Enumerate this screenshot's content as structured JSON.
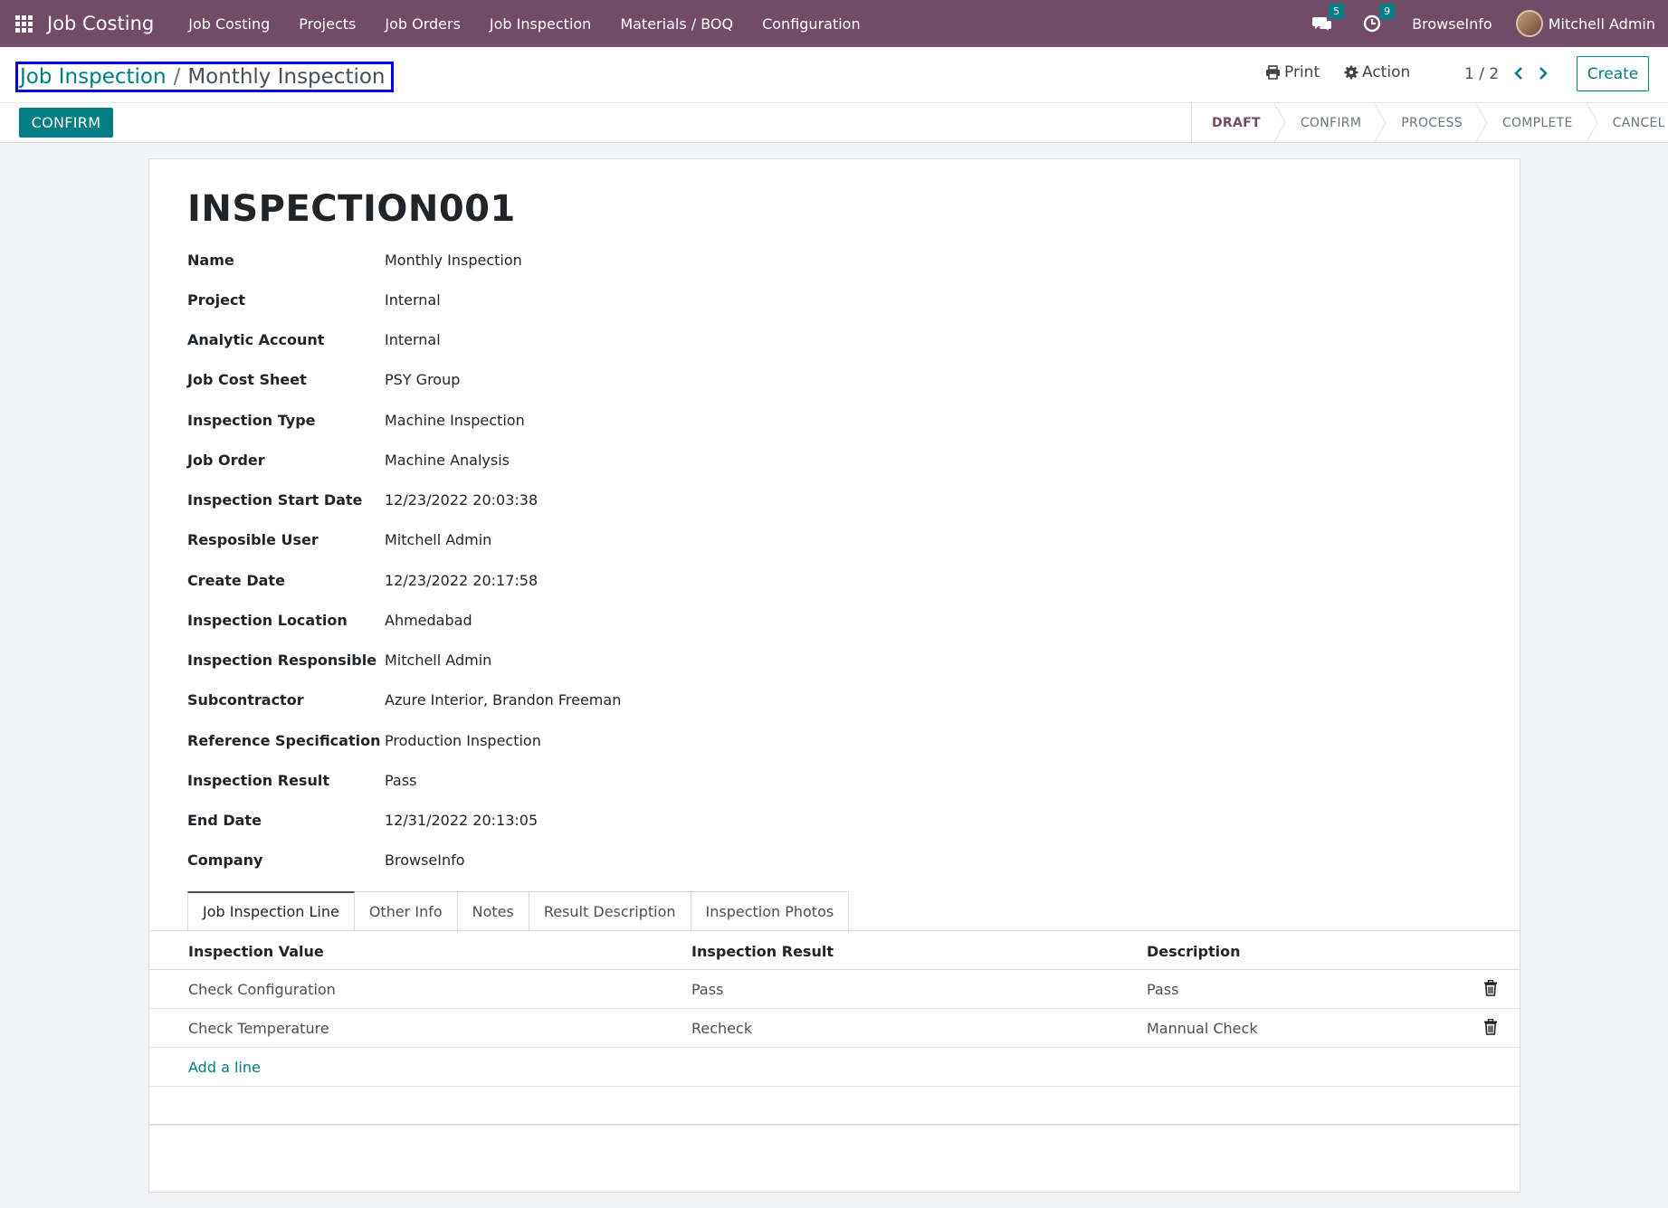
{
  "navbar": {
    "app_name": "Job Costing",
    "menu": [
      "Job Costing",
      "Projects",
      "Job Orders",
      "Job Inspection",
      "Materials / BOQ",
      "Configuration"
    ],
    "messages_count": "5",
    "activities_count": "9",
    "company": "BrowseInfo",
    "user": "Mitchell Admin"
  },
  "control": {
    "breadcrumb_parent": "Job Inspection",
    "breadcrumb_separator": "/",
    "breadcrumb_current": "Monthly Inspection",
    "print_label": "Print",
    "action_label": "Action",
    "pager": "1 / 2",
    "create_label": "Create",
    "confirm_label": "CONFIRM"
  },
  "statusbar": {
    "stages": [
      "DRAFT",
      "CONFIRM",
      "PROCESS",
      "COMPLETE",
      "CANCEL"
    ],
    "active": "DRAFT"
  },
  "record": {
    "title": "INSPECTION001",
    "fields": [
      {
        "label": "Name",
        "value": "Monthly Inspection"
      },
      {
        "label": "Project",
        "value": "Internal"
      },
      {
        "label": "Analytic Account",
        "value": "Internal"
      },
      {
        "label": "Job Cost Sheet",
        "value": "PSY Group"
      },
      {
        "label": "Inspection Type",
        "value": "Machine Inspection"
      },
      {
        "label": "Job Order",
        "value": "Machine Analysis"
      },
      {
        "label": "Inspection Start Date",
        "value": "12/23/2022 20:03:38"
      },
      {
        "label": "Resposible User",
        "value": "Mitchell Admin"
      },
      {
        "label": "Create Date",
        "value": "12/23/2022 20:17:58"
      },
      {
        "label": "Inspection Location",
        "value": "Ahmedabad"
      },
      {
        "label": "Inspection Responsible",
        "value": "Mitchell Admin"
      },
      {
        "label": "Subcontractor",
        "value": "Azure Interior, Brandon Freeman"
      },
      {
        "label": "Reference Specification",
        "value": "Production Inspection"
      },
      {
        "label": "Inspection Result",
        "value": "Pass"
      },
      {
        "label": "End Date",
        "value": "12/31/2022 20:13:05"
      },
      {
        "label": "Company",
        "value": "BrowseInfo"
      }
    ]
  },
  "tabs": [
    "Job Inspection Line",
    "Other Info",
    "Notes",
    "Result Description",
    "Inspection Photos"
  ],
  "table": {
    "columns": [
      "Inspection Value",
      "Inspection Result",
      "Description"
    ],
    "rows": [
      {
        "value": "Check Configuration",
        "result": "Pass",
        "description": "Pass"
      },
      {
        "value": "Check Temperature",
        "result": "Recheck",
        "description": "Mannual Check"
      }
    ],
    "add_line_label": "Add a line"
  },
  "colors": {
    "navbar": "#714b67",
    "accent": "#017e84",
    "highlight_box": "#0000ee"
  }
}
